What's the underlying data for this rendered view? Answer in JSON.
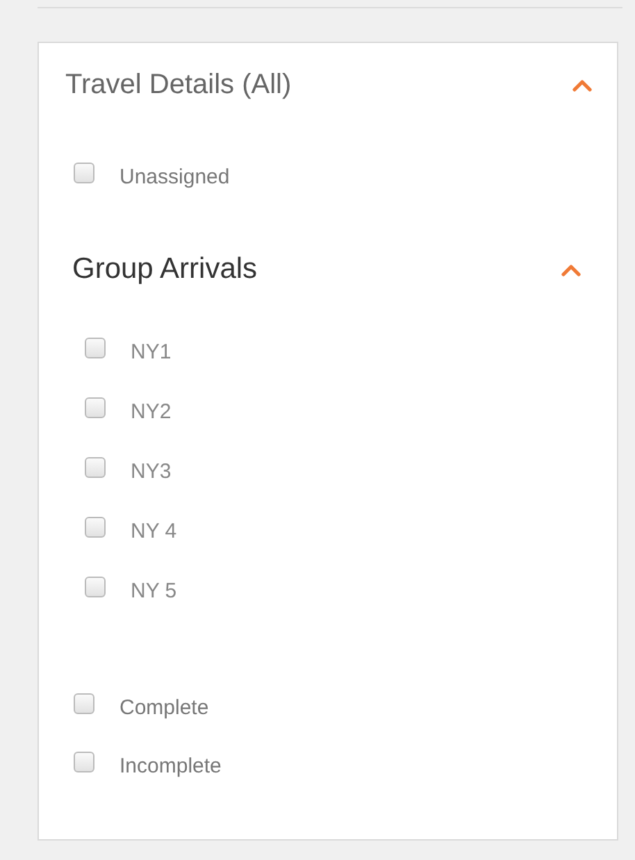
{
  "panel": {
    "title": "Travel Details (All)",
    "expanded": true,
    "items": [
      {
        "label": "Unassigned",
        "checked": false
      }
    ],
    "group": {
      "title": "Group Arrivals",
      "expanded": true,
      "items": [
        {
          "label": "NY1",
          "checked": false
        },
        {
          "label": "NY2",
          "checked": false
        },
        {
          "label": "NY3",
          "checked": false
        },
        {
          "label": "NY 4",
          "checked": false
        },
        {
          "label": "NY 5",
          "checked": false
        }
      ]
    },
    "status_items": [
      {
        "label": "Complete",
        "checked": false
      },
      {
        "label": "Incomplete",
        "checked": false
      }
    ]
  }
}
